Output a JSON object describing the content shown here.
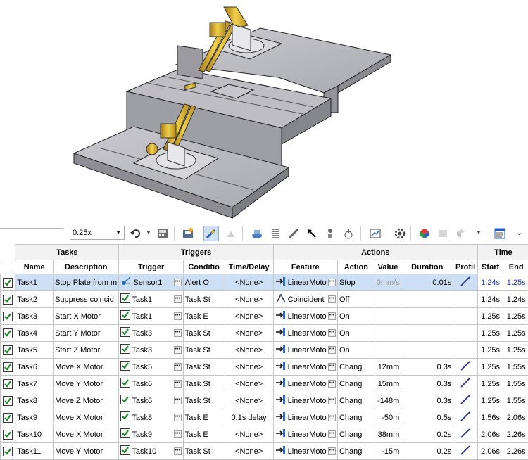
{
  "toolbar": {
    "zoom": "0.25x",
    "icons": [
      "undo-icon",
      "calculate-icon",
      "save-animation-icon",
      "autokey-icon",
      "motor-icon",
      "spring-icon",
      "damper-icon",
      "force-icon",
      "contact-icon",
      "gravity-icon",
      "results-icon",
      "study-properties-icon",
      "simulation-icon",
      "simulation-setup-icon",
      "event-list-icon"
    ]
  },
  "table": {
    "groups": {
      "tasks": "Tasks",
      "triggers": "Triggers",
      "actions": "Actions",
      "time": "Time"
    },
    "columns": {
      "name": "Name",
      "description": "Description",
      "trigger": "Trigger",
      "condition": "Conditio",
      "time_delay": "Time/Delay",
      "feature": "Feature",
      "action": "Action",
      "value": "Value",
      "duration": "Duration",
      "profile": "Profil",
      "start": "Start",
      "end": "End"
    },
    "rows": [
      {
        "name": "Task1",
        "description": "Stop Plate from m",
        "trigger": "Sensor1",
        "trigger_type": "sensor",
        "condition": "Alert O",
        "delay": "<None>",
        "feature": "LinearMoto",
        "feature_type": "motor",
        "action": "Stop",
        "value": "0mm/s",
        "duration": "0.01s",
        "profile": true,
        "start": "1.24s",
        "end": "1.25s",
        "selected": true
      },
      {
        "name": "Task2",
        "description": "Suppress coincid",
        "trigger": "Task1",
        "trigger_type": "task",
        "condition": "Task St",
        "delay": "<None>",
        "feature": "Coincident",
        "feature_type": "mate",
        "action": "Off",
        "value": "",
        "duration": "",
        "profile": false,
        "start": "1.24s",
        "end": "1.24s"
      },
      {
        "name": "Task3",
        "description": "Start X Motor",
        "trigger": "Task1",
        "trigger_type": "task",
        "condition": "Task E",
        "delay": "<None>",
        "feature": "LinearMoto",
        "feature_type": "motor",
        "action": "On",
        "value": "",
        "duration": "",
        "profile": false,
        "start": "1.25s",
        "end": "1.25s"
      },
      {
        "name": "Task4",
        "description": "Start Y Motor",
        "trigger": "Task3",
        "trigger_type": "task",
        "condition": "Task St",
        "delay": "<None>",
        "feature": "LinearMoto",
        "feature_type": "motor",
        "action": "On",
        "value": "",
        "duration": "",
        "profile": false,
        "start": "1.25s",
        "end": "1.25s"
      },
      {
        "name": "Task5",
        "description": "Start Z Motor",
        "trigger": "Task3",
        "trigger_type": "task",
        "condition": "Task St",
        "delay": "<None>",
        "feature": "LinearMoto",
        "feature_type": "motor",
        "action": "On",
        "value": "",
        "duration": "",
        "profile": false,
        "start": "1.25s",
        "end": "1.25s"
      },
      {
        "name": "Task6",
        "description": "Move X Motor",
        "trigger": "Task5",
        "trigger_type": "task",
        "condition": "Task St",
        "delay": "<None>",
        "feature": "LinearMoto",
        "feature_type": "motor",
        "action": "Chang",
        "value": "12mm",
        "duration": "0.3s",
        "profile": true,
        "start": "1.25s",
        "end": "1.55s"
      },
      {
        "name": "Task7",
        "description": "Move Y Motor",
        "trigger": "Task6",
        "trigger_type": "task",
        "condition": "Task St",
        "delay": "<None>",
        "feature": "LinearMoto",
        "feature_type": "motor",
        "action": "Chang",
        "value": "15mm",
        "duration": "0.3s",
        "profile": true,
        "start": "1.25s",
        "end": "1.55s"
      },
      {
        "name": "Task8",
        "description": "Move Z Motor",
        "trigger": "Task6",
        "trigger_type": "task",
        "condition": "Task St",
        "delay": "<None>",
        "feature": "LinearMoto",
        "feature_type": "motor",
        "action": "Chang",
        "value": "-148m",
        "duration": "0.3s",
        "profile": true,
        "start": "1.25s",
        "end": "1.55s"
      },
      {
        "name": "Task9",
        "description": "Move X Motor",
        "trigger": "Task8",
        "trigger_type": "task",
        "condition": "Task E",
        "delay": "0.1s delay",
        "feature": "LinearMoto",
        "feature_type": "motor",
        "action": "Chang",
        "value": "-50m",
        "duration": "0.5s",
        "profile": true,
        "start": "1.56s",
        "end": "2.06s"
      },
      {
        "name": "Task10",
        "description": "Move X Motor",
        "trigger": "Task9",
        "trigger_type": "task",
        "condition": "Task E",
        "delay": "<None>",
        "feature": "LinearMoto",
        "feature_type": "motor",
        "action": "Chang",
        "value": "38mm",
        "duration": "0.2s",
        "profile": true,
        "start": "2.06s",
        "end": "2.26s"
      },
      {
        "name": "Task11",
        "description": "Move Y Motor",
        "trigger": "Task10",
        "trigger_type": "task",
        "condition": "Task St",
        "delay": "<None>",
        "feature": "LinearMoto",
        "feature_type": "motor",
        "action": "Chang",
        "value": "-15m",
        "duration": "0.2s",
        "profile": true,
        "start": "2.06s",
        "end": "2.26s"
      }
    ]
  },
  "colors": {
    "selected_row": "#cddff4",
    "time_highlight": "#1a3bd4",
    "model_gray": "#b3b3b8",
    "arm_gold": "#e0b52e"
  }
}
